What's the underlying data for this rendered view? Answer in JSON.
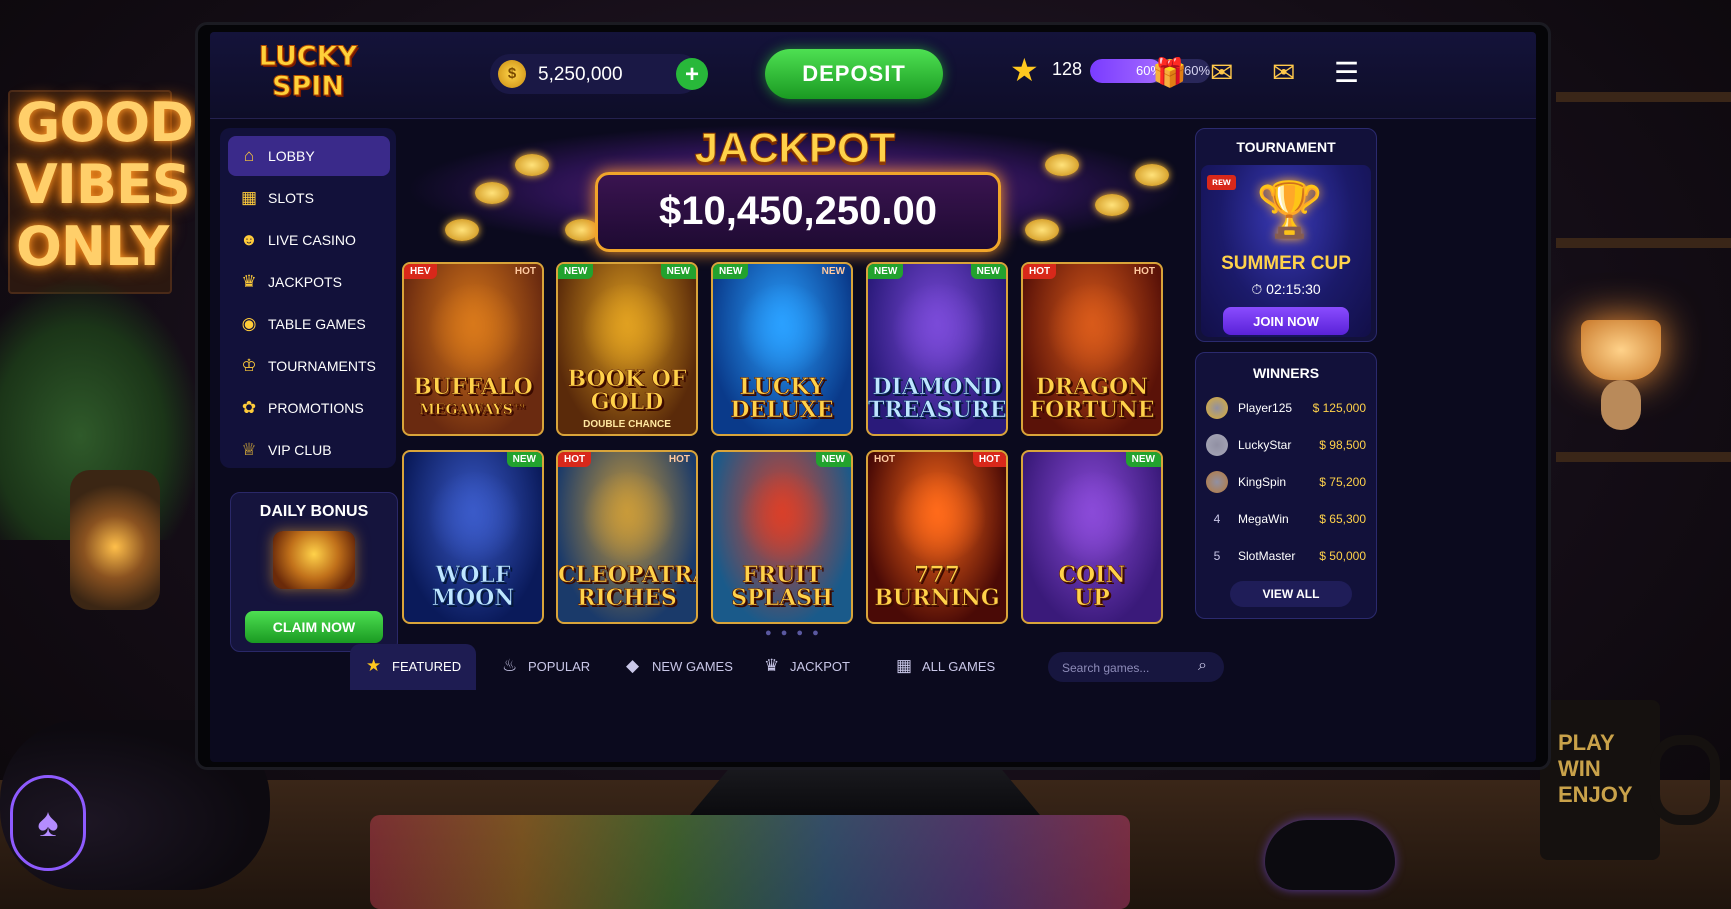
{
  "room": {
    "neon_sign": [
      "GOOD",
      "VIBES",
      "ONLY"
    ],
    "mug_text": [
      "PLAY",
      "WIN",
      "ENJOY"
    ]
  },
  "brand": {
    "logo_line1": "LUCKY",
    "logo_line2": "SPIN"
  },
  "header": {
    "coin_balance": "5,250,000",
    "add_coins_icon": "plus-icon",
    "deposit_label": "DEPOSIT",
    "level": "128",
    "xp_progress_percent": 60,
    "xp_fill_label": "60%",
    "xp_label": "60%",
    "icons": [
      "gift-icon",
      "mail-icon",
      "inbox-icon",
      "menu-icon"
    ]
  },
  "sidebar": {
    "items": [
      {
        "label": "LOBBY",
        "icon": "home-icon",
        "active": true
      },
      {
        "label": "SLOTS",
        "icon": "slot-machine-icon"
      },
      {
        "label": "LIVE CASINO",
        "icon": "dealer-icon"
      },
      {
        "label": "JACKPOTS",
        "icon": "crown-icon"
      },
      {
        "label": "TABLE GAMES",
        "icon": "chip-icon"
      },
      {
        "label": "TOURNAMENTS",
        "icon": "trophy-icon"
      },
      {
        "label": "PROMOTIONS",
        "icon": "gift-icon"
      },
      {
        "label": "VIP CLUB",
        "icon": "vip-crown-icon"
      }
    ]
  },
  "daily_bonus": {
    "title": "DAILY BONUS",
    "claim_label": "CLAIM NOW"
  },
  "jackpot": {
    "title": "JACKPOT",
    "amount": "$10,450,250.00"
  },
  "games": [
    {
      "title1": "BUFFALO",
      "title2": "MEGAWAYS™",
      "badge_left": "HEV",
      "badge_right": "HOT",
      "left_style": "hot",
      "right_style": "hot-text",
      "palette": "#6a2a10,#d8781a"
    },
    {
      "title1": "BOOK OF",
      "title2": "GOLD",
      "sub": "DOUBLE CHANCE",
      "badge_left": "NEW",
      "badge_right": "NEW",
      "left_style": "new",
      "right_style": "new",
      "palette": "#5a2a0a,#e0a020"
    },
    {
      "title1": "LUCKY",
      "title2": "DELUXE",
      "badge_left": "NEW",
      "badge_right": "NEW",
      "left_style": "new",
      "right_style": "hot-text",
      "palette": "#0a3a8a,#2aa0ff"
    },
    {
      "title1": "DIAMOND",
      "title2": "TREASURE",
      "badge_left": "NEW",
      "badge_right": "NEW",
      "left_style": "new",
      "right_style": "new",
      "palette": "#2a1a7a,#7a4ad8",
      "blue": true
    },
    {
      "title1": "DRAGON",
      "title2": "FORTUNE",
      "badge_left": "HOT",
      "badge_right": "HOT",
      "left_style": "hot",
      "right_style": "hot-text",
      "palette": "#5a1208,#d85a1a"
    },
    {
      "title1": "WOLF",
      "title2": "MOON",
      "badge_right": "NEW",
      "right_style": "new",
      "palette": "#0a1a5a,#3a5ac8",
      "blue": true
    },
    {
      "title1": "CLEOPATRA",
      "title2": "RICHES",
      "badge_left": "HOT",
      "badge_right": "HOT",
      "left_style": "hot",
      "right_style": "hot-text",
      "palette": "#1a3a6a,#c89a3a"
    },
    {
      "title1": "FRUIT",
      "title2": "SPLASH",
      "badge_right": "NEW",
      "right_style": "new",
      "palette": "#1a5a8a,#d8402a"
    },
    {
      "title1": "777",
      "title2": "BURNING",
      "badge_left": "HOT",
      "badge_right": "HOT",
      "left_style": "hot-text",
      "right_style": "hot",
      "palette": "#4a0a06,#ff6a1a"
    },
    {
      "title1": "COIN",
      "title2": "UP",
      "badge_right": "NEW",
      "right_style": "new",
      "palette": "#3a1a7a,#8a4ad8"
    }
  ],
  "carousel_dots": "● ● ● ●",
  "tournament": {
    "title": "TOURNAMENT",
    "new_badge": "ʀᴇᴡ",
    "name": "SUMMER CUP",
    "timer": "⏱ 02:15:30",
    "join_label": "JOIN NOW"
  },
  "winners": {
    "title": "WINNERS",
    "rows": [
      {
        "rank": "",
        "name": "Player125",
        "amount": "$ 125,000",
        "medal": "#e0b030"
      },
      {
        "rank": "",
        "name": "LuckyStar",
        "amount": "$ 98,500",
        "medal": "#a8a8b8"
      },
      {
        "rank": "",
        "name": "KingSpin",
        "amount": "$ 75,200",
        "medal": "#b87a3a"
      },
      {
        "rank": "4",
        "name": "MegaWin",
        "amount": "$ 65,300"
      },
      {
        "rank": "5",
        "name": "SlotMaster",
        "amount": "$ 50,000"
      }
    ],
    "view_all_label": "VIEW ALL"
  },
  "tabs": [
    {
      "label": "FEATURED",
      "icon": "star-icon",
      "active": true
    },
    {
      "label": "POPULAR",
      "icon": "flame-icon"
    },
    {
      "label": "NEW GAMES",
      "icon": "diamond-icon"
    },
    {
      "label": "JACKPOT",
      "icon": "crown-icon"
    },
    {
      "label": "ALL GAMES",
      "icon": "grid-icon"
    }
  ],
  "search": {
    "placeholder": "Search games..."
  }
}
